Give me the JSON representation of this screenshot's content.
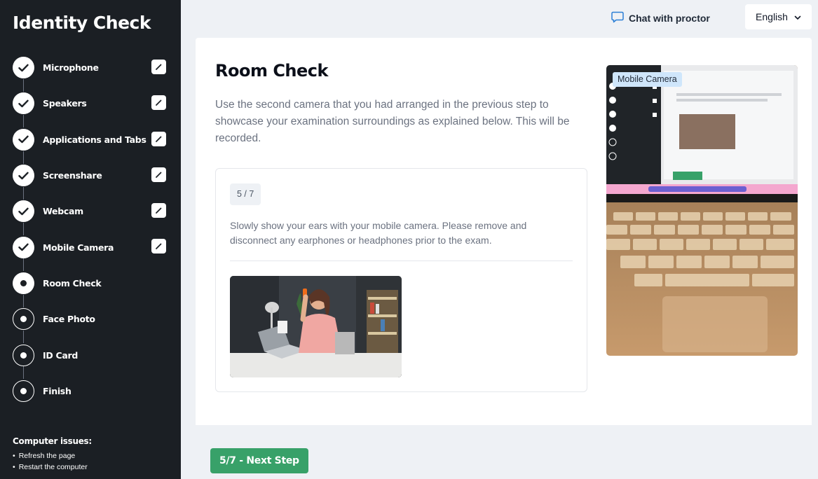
{
  "sidebar": {
    "title": "Identity Check",
    "steps": [
      {
        "label": "Microphone",
        "status": "done",
        "editable": true
      },
      {
        "label": "Speakers",
        "status": "done",
        "editable": true
      },
      {
        "label": "Applications and Tabs",
        "status": "done",
        "editable": true
      },
      {
        "label": "Screenshare",
        "status": "done",
        "editable": true
      },
      {
        "label": "Webcam",
        "status": "done",
        "editable": true
      },
      {
        "label": "Mobile Camera",
        "status": "done",
        "editable": true
      },
      {
        "label": "Room Check",
        "status": "current",
        "editable": false
      },
      {
        "label": "Face Photo",
        "status": "pending",
        "editable": false
      },
      {
        "label": "ID Card",
        "status": "pending",
        "editable": false
      },
      {
        "label": "Finish",
        "status": "pending",
        "editable": false
      }
    ],
    "issues": {
      "title": "Computer issues:",
      "items": [
        "Refresh the page",
        "Restart the computer"
      ]
    }
  },
  "topbar": {
    "chat_label": "Chat with proctor",
    "chat_icon": "chat-bubble-icon",
    "language": "English"
  },
  "main": {
    "title": "Room Check",
    "description": "Use the second camera that you had arranged in the previous step to showcase your examination surroundings as explained below. This will be recorded.",
    "step_badge": "5 / 7",
    "instruction": "Slowly show your ears with your mobile camera. Please remove and disconnect any earphones or headphones prior to the exam.",
    "camera_tag": "Mobile Camera"
  },
  "footer": {
    "next_label": "5/7 - Next Step"
  },
  "colors": {
    "sidebar_bg": "#1b1f24",
    "accent_green": "#38a169",
    "camera_tag_bg": "#cfe6fb",
    "page_bg": "#eef1f5"
  }
}
